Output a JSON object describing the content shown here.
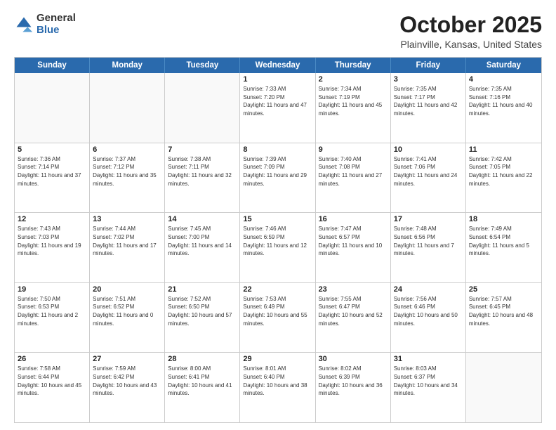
{
  "logo": {
    "general": "General",
    "blue": "Blue"
  },
  "title": "October 2025",
  "subtitle": "Plainville, Kansas, United States",
  "days_of_week": [
    "Sunday",
    "Monday",
    "Tuesday",
    "Wednesday",
    "Thursday",
    "Friday",
    "Saturday"
  ],
  "weeks": [
    [
      {
        "day": "",
        "empty": true
      },
      {
        "day": "",
        "empty": true
      },
      {
        "day": "",
        "empty": true
      },
      {
        "day": "1",
        "sunrise": "7:33 AM",
        "sunset": "7:20 PM",
        "daylight": "11 hours and 47 minutes."
      },
      {
        "day": "2",
        "sunrise": "7:34 AM",
        "sunset": "7:19 PM",
        "daylight": "11 hours and 45 minutes."
      },
      {
        "day": "3",
        "sunrise": "7:35 AM",
        "sunset": "7:17 PM",
        "daylight": "11 hours and 42 minutes."
      },
      {
        "day": "4",
        "sunrise": "7:35 AM",
        "sunset": "7:16 PM",
        "daylight": "11 hours and 40 minutes."
      }
    ],
    [
      {
        "day": "5",
        "sunrise": "7:36 AM",
        "sunset": "7:14 PM",
        "daylight": "11 hours and 37 minutes."
      },
      {
        "day": "6",
        "sunrise": "7:37 AM",
        "sunset": "7:12 PM",
        "daylight": "11 hours and 35 minutes."
      },
      {
        "day": "7",
        "sunrise": "7:38 AM",
        "sunset": "7:11 PM",
        "daylight": "11 hours and 32 minutes."
      },
      {
        "day": "8",
        "sunrise": "7:39 AM",
        "sunset": "7:09 PM",
        "daylight": "11 hours and 29 minutes."
      },
      {
        "day": "9",
        "sunrise": "7:40 AM",
        "sunset": "7:08 PM",
        "daylight": "11 hours and 27 minutes."
      },
      {
        "day": "10",
        "sunrise": "7:41 AM",
        "sunset": "7:06 PM",
        "daylight": "11 hours and 24 minutes."
      },
      {
        "day": "11",
        "sunrise": "7:42 AM",
        "sunset": "7:05 PM",
        "daylight": "11 hours and 22 minutes."
      }
    ],
    [
      {
        "day": "12",
        "sunrise": "7:43 AM",
        "sunset": "7:03 PM",
        "daylight": "11 hours and 19 minutes."
      },
      {
        "day": "13",
        "sunrise": "7:44 AM",
        "sunset": "7:02 PM",
        "daylight": "11 hours and 17 minutes."
      },
      {
        "day": "14",
        "sunrise": "7:45 AM",
        "sunset": "7:00 PM",
        "daylight": "11 hours and 14 minutes."
      },
      {
        "day": "15",
        "sunrise": "7:46 AM",
        "sunset": "6:59 PM",
        "daylight": "11 hours and 12 minutes."
      },
      {
        "day": "16",
        "sunrise": "7:47 AM",
        "sunset": "6:57 PM",
        "daylight": "11 hours and 10 minutes."
      },
      {
        "day": "17",
        "sunrise": "7:48 AM",
        "sunset": "6:56 PM",
        "daylight": "11 hours and 7 minutes."
      },
      {
        "day": "18",
        "sunrise": "7:49 AM",
        "sunset": "6:54 PM",
        "daylight": "11 hours and 5 minutes."
      }
    ],
    [
      {
        "day": "19",
        "sunrise": "7:50 AM",
        "sunset": "6:53 PM",
        "daylight": "11 hours and 2 minutes."
      },
      {
        "day": "20",
        "sunrise": "7:51 AM",
        "sunset": "6:52 PM",
        "daylight": "11 hours and 0 minutes."
      },
      {
        "day": "21",
        "sunrise": "7:52 AM",
        "sunset": "6:50 PM",
        "daylight": "10 hours and 57 minutes."
      },
      {
        "day": "22",
        "sunrise": "7:53 AM",
        "sunset": "6:49 PM",
        "daylight": "10 hours and 55 minutes."
      },
      {
        "day": "23",
        "sunrise": "7:55 AM",
        "sunset": "6:47 PM",
        "daylight": "10 hours and 52 minutes."
      },
      {
        "day": "24",
        "sunrise": "7:56 AM",
        "sunset": "6:46 PM",
        "daylight": "10 hours and 50 minutes."
      },
      {
        "day": "25",
        "sunrise": "7:57 AM",
        "sunset": "6:45 PM",
        "daylight": "10 hours and 48 minutes."
      }
    ],
    [
      {
        "day": "26",
        "sunrise": "7:58 AM",
        "sunset": "6:44 PM",
        "daylight": "10 hours and 45 minutes."
      },
      {
        "day": "27",
        "sunrise": "7:59 AM",
        "sunset": "6:42 PM",
        "daylight": "10 hours and 43 minutes."
      },
      {
        "day": "28",
        "sunrise": "8:00 AM",
        "sunset": "6:41 PM",
        "daylight": "10 hours and 41 minutes."
      },
      {
        "day": "29",
        "sunrise": "8:01 AM",
        "sunset": "6:40 PM",
        "daylight": "10 hours and 38 minutes."
      },
      {
        "day": "30",
        "sunrise": "8:02 AM",
        "sunset": "6:39 PM",
        "daylight": "10 hours and 36 minutes."
      },
      {
        "day": "31",
        "sunrise": "8:03 AM",
        "sunset": "6:37 PM",
        "daylight": "10 hours and 34 minutes."
      },
      {
        "day": "",
        "empty": true
      }
    ]
  ]
}
